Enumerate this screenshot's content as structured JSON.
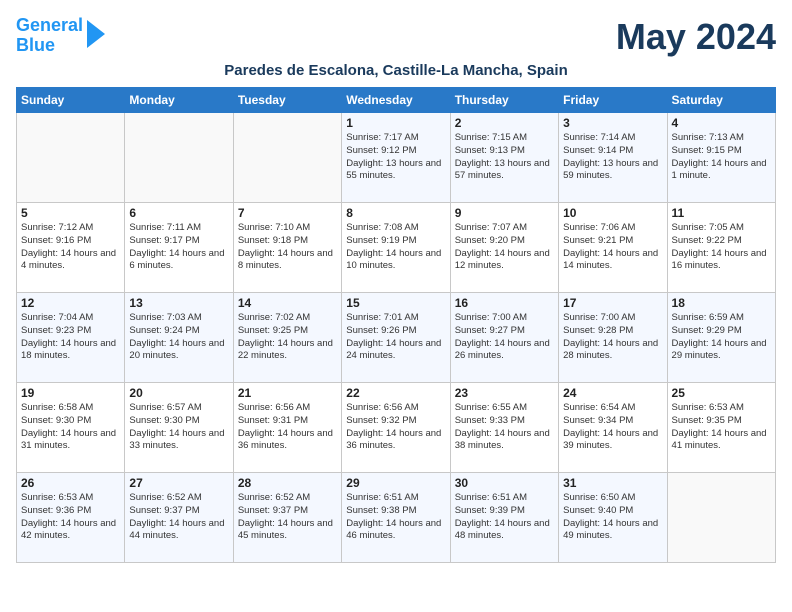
{
  "header": {
    "logo_line1": "General",
    "logo_line2": "Blue",
    "month_year": "May 2024",
    "location": "Paredes de Escalona, Castille-La Mancha, Spain"
  },
  "days_of_week": [
    "Sunday",
    "Monday",
    "Tuesday",
    "Wednesday",
    "Thursday",
    "Friday",
    "Saturday"
  ],
  "weeks": [
    [
      {
        "day": "",
        "content": ""
      },
      {
        "day": "",
        "content": ""
      },
      {
        "day": "",
        "content": ""
      },
      {
        "day": "1",
        "content": "Sunrise: 7:17 AM\nSunset: 9:12 PM\nDaylight: 13 hours\nand 55 minutes."
      },
      {
        "day": "2",
        "content": "Sunrise: 7:15 AM\nSunset: 9:13 PM\nDaylight: 13 hours\nand 57 minutes."
      },
      {
        "day": "3",
        "content": "Sunrise: 7:14 AM\nSunset: 9:14 PM\nDaylight: 13 hours\nand 59 minutes."
      },
      {
        "day": "4",
        "content": "Sunrise: 7:13 AM\nSunset: 9:15 PM\nDaylight: 14 hours\nand 1 minute."
      }
    ],
    [
      {
        "day": "5",
        "content": "Sunrise: 7:12 AM\nSunset: 9:16 PM\nDaylight: 14 hours\nand 4 minutes."
      },
      {
        "day": "6",
        "content": "Sunrise: 7:11 AM\nSunset: 9:17 PM\nDaylight: 14 hours\nand 6 minutes."
      },
      {
        "day": "7",
        "content": "Sunrise: 7:10 AM\nSunset: 9:18 PM\nDaylight: 14 hours\nand 8 minutes."
      },
      {
        "day": "8",
        "content": "Sunrise: 7:08 AM\nSunset: 9:19 PM\nDaylight: 14 hours\nand 10 minutes."
      },
      {
        "day": "9",
        "content": "Sunrise: 7:07 AM\nSunset: 9:20 PM\nDaylight: 14 hours\nand 12 minutes."
      },
      {
        "day": "10",
        "content": "Sunrise: 7:06 AM\nSunset: 9:21 PM\nDaylight: 14 hours\nand 14 minutes."
      },
      {
        "day": "11",
        "content": "Sunrise: 7:05 AM\nSunset: 9:22 PM\nDaylight: 14 hours\nand 16 minutes."
      }
    ],
    [
      {
        "day": "12",
        "content": "Sunrise: 7:04 AM\nSunset: 9:23 PM\nDaylight: 14 hours\nand 18 minutes."
      },
      {
        "day": "13",
        "content": "Sunrise: 7:03 AM\nSunset: 9:24 PM\nDaylight: 14 hours\nand 20 minutes."
      },
      {
        "day": "14",
        "content": "Sunrise: 7:02 AM\nSunset: 9:25 PM\nDaylight: 14 hours\nand 22 minutes."
      },
      {
        "day": "15",
        "content": "Sunrise: 7:01 AM\nSunset: 9:26 PM\nDaylight: 14 hours\nand 24 minutes."
      },
      {
        "day": "16",
        "content": "Sunrise: 7:00 AM\nSunset: 9:27 PM\nDaylight: 14 hours\nand 26 minutes."
      },
      {
        "day": "17",
        "content": "Sunrise: 7:00 AM\nSunset: 9:28 PM\nDaylight: 14 hours\nand 28 minutes."
      },
      {
        "day": "18",
        "content": "Sunrise: 6:59 AM\nSunset: 9:29 PM\nDaylight: 14 hours\nand 29 minutes."
      }
    ],
    [
      {
        "day": "19",
        "content": "Sunrise: 6:58 AM\nSunset: 9:30 PM\nDaylight: 14 hours\nand 31 minutes."
      },
      {
        "day": "20",
        "content": "Sunrise: 6:57 AM\nSunset: 9:30 PM\nDaylight: 14 hours\nand 33 minutes."
      },
      {
        "day": "21",
        "content": "Sunrise: 6:56 AM\nSunset: 9:31 PM\nDaylight: 14 hours\nand 36 minutes."
      },
      {
        "day": "22",
        "content": "Sunrise: 6:56 AM\nSunset: 9:32 PM\nDaylight: 14 hours\nand 36 minutes."
      },
      {
        "day": "23",
        "content": "Sunrise: 6:55 AM\nSunset: 9:33 PM\nDaylight: 14 hours\nand 38 minutes."
      },
      {
        "day": "24",
        "content": "Sunrise: 6:54 AM\nSunset: 9:34 PM\nDaylight: 14 hours\nand 39 minutes."
      },
      {
        "day": "25",
        "content": "Sunrise: 6:53 AM\nSunset: 9:35 PM\nDaylight: 14 hours\nand 41 minutes."
      }
    ],
    [
      {
        "day": "26",
        "content": "Sunrise: 6:53 AM\nSunset: 9:36 PM\nDaylight: 14 hours\nand 42 minutes."
      },
      {
        "day": "27",
        "content": "Sunrise: 6:52 AM\nSunset: 9:37 PM\nDaylight: 14 hours\nand 44 minutes."
      },
      {
        "day": "28",
        "content": "Sunrise: 6:52 AM\nSunset: 9:37 PM\nDaylight: 14 hours\nand 45 minutes."
      },
      {
        "day": "29",
        "content": "Sunrise: 6:51 AM\nSunset: 9:38 PM\nDaylight: 14 hours\nand 46 minutes."
      },
      {
        "day": "30",
        "content": "Sunrise: 6:51 AM\nSunset: 9:39 PM\nDaylight: 14 hours\nand 48 minutes."
      },
      {
        "day": "31",
        "content": "Sunrise: 6:50 AM\nSunset: 9:40 PM\nDaylight: 14 hours\nand 49 minutes."
      },
      {
        "day": "",
        "content": ""
      }
    ]
  ]
}
